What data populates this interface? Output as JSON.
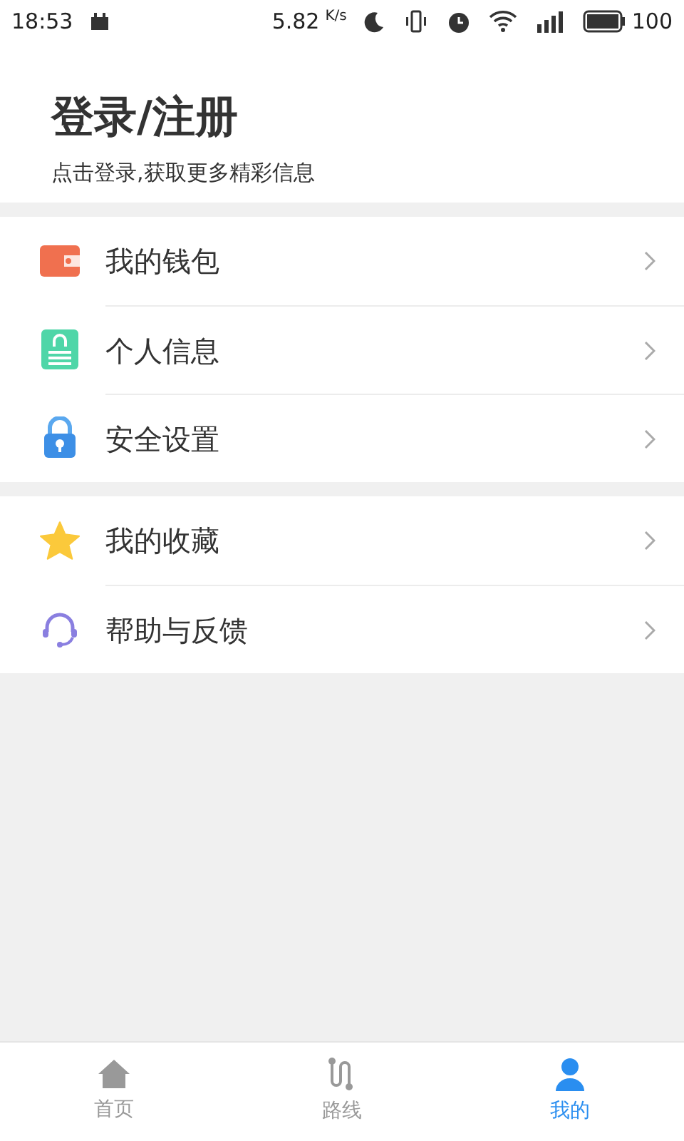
{
  "status_bar": {
    "time": "18:53",
    "speed": "5.82",
    "speed_unit": "K/s",
    "battery": "100"
  },
  "header": {
    "title": "登录/注册",
    "subtitle": "点击登录,获取更多精彩信息"
  },
  "menu_groups": [
    [
      {
        "label": "我的钱包",
        "kind": "wallet"
      },
      {
        "label": "个人信息",
        "kind": "profile"
      },
      {
        "label": "安全设置",
        "kind": "lock"
      }
    ],
    [
      {
        "label": "我的收藏",
        "kind": "star"
      },
      {
        "label": "帮助与反馈",
        "kind": "headset"
      }
    ]
  ],
  "tabs": [
    {
      "label": "首页",
      "kind": "home",
      "selected": false
    },
    {
      "label": "路线",
      "kind": "route",
      "selected": false
    },
    {
      "label": "我的",
      "kind": "person",
      "selected": true
    }
  ]
}
